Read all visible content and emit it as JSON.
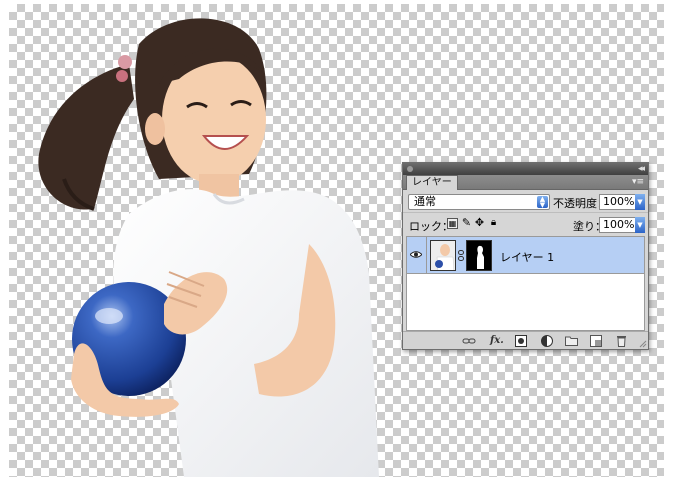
{
  "layers_panel": {
    "tab_label": "レイヤー",
    "blend_mode": "通常",
    "opacity_label": "不透明度：",
    "opacity_value": "100%",
    "lock_label": "ロック：",
    "fill_label": "塗り：",
    "fill_value": "100%",
    "layers": [
      {
        "name": "レイヤー 1",
        "visible": true,
        "selected": true
      }
    ],
    "footer_buttons": [
      "link-layers",
      "fx",
      "add-mask",
      "adjustment-layer",
      "new-group",
      "new-layer",
      "delete-layer"
    ]
  },
  "colors": {
    "selected_row": "#b6cff4",
    "panel_bg": "#d6d6d6",
    "accent_blue": "#2c64c8"
  }
}
